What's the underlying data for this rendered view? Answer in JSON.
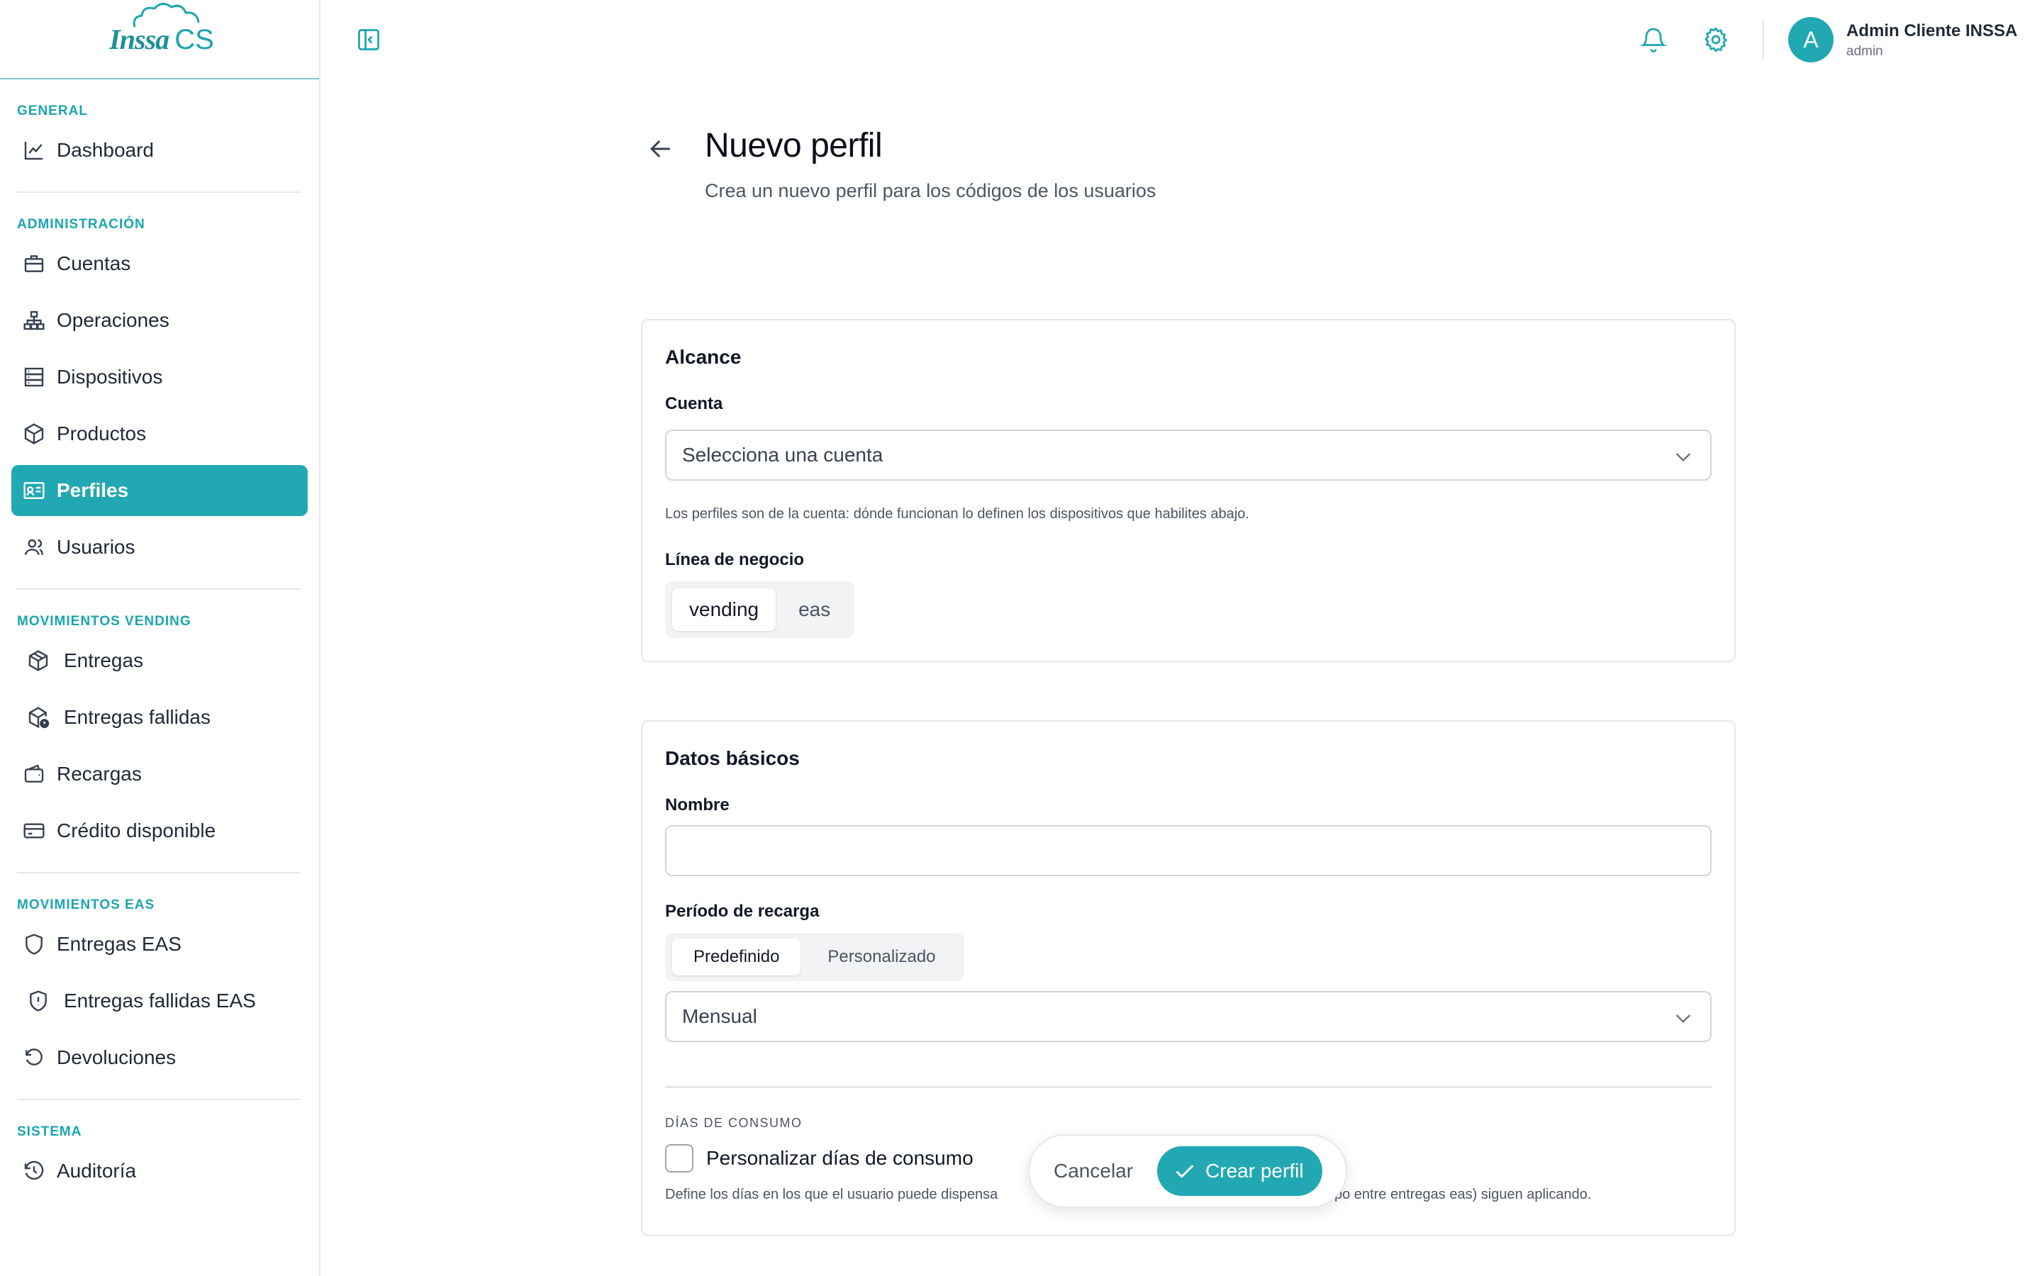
{
  "app": {
    "logo_brand": "Inssa",
    "logo_suffix": "CS"
  },
  "sidebar": {
    "sections": [
      {
        "label": "GENERAL",
        "items": [
          {
            "label": "Dashboard",
            "icon": "chart-line-icon"
          }
        ]
      },
      {
        "label": "ADMINISTRACIÓN",
        "items": [
          {
            "label": "Cuentas",
            "icon": "briefcase-icon"
          },
          {
            "label": "Operaciones",
            "icon": "hierarchy-icon"
          },
          {
            "label": "Dispositivos",
            "icon": "server-icon"
          },
          {
            "label": "Productos",
            "icon": "box-icon"
          },
          {
            "label": "Perfiles",
            "icon": "id-card-icon",
            "active": true
          },
          {
            "label": "Usuarios",
            "icon": "users-icon"
          }
        ]
      },
      {
        "label": "MOVIMIENTOS VENDING",
        "items": [
          {
            "label": "Entregas",
            "icon": "package-icon"
          },
          {
            "label": "Entregas fallidas",
            "icon": "package-alert-icon"
          },
          {
            "label": "Recargas",
            "icon": "wallet-icon"
          },
          {
            "label": "Crédito disponible",
            "icon": "credit-card-icon"
          }
        ]
      },
      {
        "label": "MOVIMIENTOS EAS",
        "items": [
          {
            "label": "Entregas EAS",
            "icon": "shield-icon"
          },
          {
            "label": "Entregas fallidas EAS",
            "icon": "shield-alert-icon"
          },
          {
            "label": "Devoluciones",
            "icon": "rotate-ccw-icon"
          }
        ]
      },
      {
        "label": "SISTEMA",
        "items": [
          {
            "label": "Auditoría",
            "icon": "history-icon"
          }
        ]
      }
    ]
  },
  "header": {
    "user_name": "Admin Cliente INSSA",
    "user_role": "admin",
    "avatar_initial": "A"
  },
  "page": {
    "title": "Nuevo perfil",
    "subtitle": "Crea un nuevo perfil para los códigos de los usuarios"
  },
  "scope_card": {
    "heading": "Alcance",
    "account_label": "Cuenta",
    "account_placeholder": "Selecciona una cuenta",
    "account_hint": "Los perfiles son de la cuenta: dónde funcionan lo definen los dispositivos que habilites abajo.",
    "business_line_label": "Línea de negocio",
    "business_line_options": [
      "vending",
      "eas"
    ],
    "business_line_selected": "vending"
  },
  "basic_card": {
    "heading": "Datos básicos",
    "name_label": "Nombre",
    "name_value": "",
    "period_label": "Período de recarga",
    "period_modes": [
      "Predefinido",
      "Personalizado"
    ],
    "period_mode_selected": "Predefinido",
    "period_value": "Mensual",
    "consumption_section": "DÍAS DE CONSUMO",
    "customize_label": "Personalizar días de consumo",
    "customize_checked": false,
    "consumption_hint_left": "Define los días en los que el usuario puede dispensa",
    "consumption_hint_right": "po entre entregas eas) siguen aplicando."
  },
  "actions": {
    "cancel_label": "Cancelar",
    "create_label": "Crear perfil"
  },
  "colors": {
    "accent": "#22a8b3",
    "accent_text": "#1aa5b0"
  }
}
